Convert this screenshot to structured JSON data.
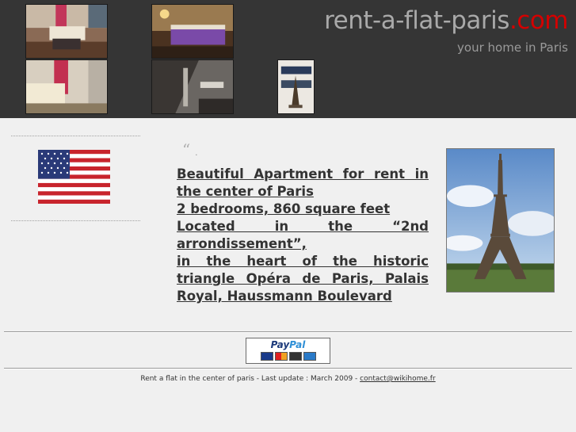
{
  "header": {
    "brand_main": "rent-a-flat-paris",
    "brand_tld": ".com",
    "tagline": "your home in Paris",
    "colors": {
      "background": "#353535",
      "brand_text": "#a9a9a9",
      "brand_accent": "#d40000"
    }
  },
  "photos": [
    {
      "icon": "living-room-photo"
    },
    {
      "icon": "bedroom-photo"
    },
    {
      "icon": "sofa-photo"
    },
    {
      "icon": "kitchen-photo"
    },
    {
      "icon": "eiffel-figurine-photo"
    }
  ],
  "sidebar": {
    "flag_icon": "us-flag-icon"
  },
  "quote": {
    "mark": "“",
    "dot": "."
  },
  "description": {
    "lines": [
      "Beautiful Apartment for rent in",
      "the center of Paris",
      "2 bedrooms, 860 square feet",
      "Located in the “2nd",
      "arrondissement”,",
      "in the heart of the historic",
      "triangle Opéra de Paris, Palais",
      "Royal, Haussmann Boulevard"
    ]
  },
  "eiffel_photo": {
    "icon": "eiffel-tower-photo"
  },
  "paypal": {
    "pay": "Pay",
    "pal": "Pal",
    "card_icons": [
      "visa-icon",
      "mastercard-icon",
      "discover-icon",
      "amex-icon"
    ]
  },
  "footer": {
    "text": "Rent a flat in the center of paris - Last update : March 2009 - ",
    "contact": "contact@wikihome.fr"
  }
}
